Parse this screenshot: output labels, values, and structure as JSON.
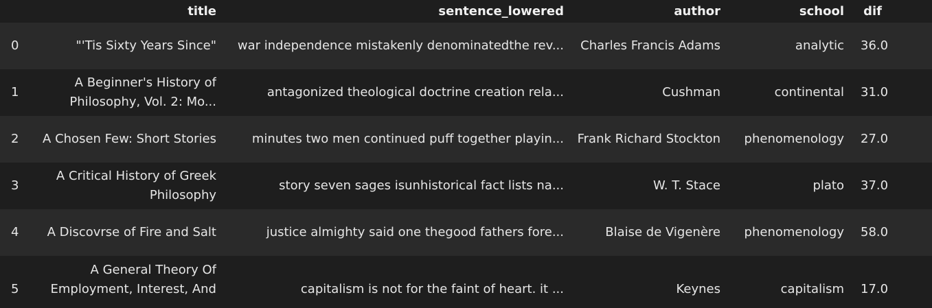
{
  "columns": {
    "index": "",
    "title": "title",
    "sentence_lowered": "sentence_lowered",
    "author": "author",
    "school": "school",
    "dif": "dif"
  },
  "rows": [
    {
      "index": "0",
      "title": "\"'Tis Sixty Years Since\"",
      "sentence_lowered": "war independence mistakenly denominatedthe rev...",
      "author": "Charles Francis Adams",
      "school": "analytic",
      "dif": "36.0"
    },
    {
      "index": "1",
      "title": "A Beginner's History of Philosophy, Vol. 2: Mo...",
      "sentence_lowered": "antagonized theological doctrine creation rela...",
      "author": "Cushman",
      "school": "continental",
      "dif": "31.0"
    },
    {
      "index": "2",
      "title": "A Chosen Few: Short Stories",
      "sentence_lowered": "minutes two men continued puff together playin...",
      "author": "Frank Richard Stockton",
      "school": "phenomenology",
      "dif": "27.0"
    },
    {
      "index": "3",
      "title": "A Critical History of Greek Philosophy",
      "sentence_lowered": "story seven sages isunhistorical fact lists na...",
      "author": "W. T. Stace",
      "school": "plato",
      "dif": "37.0"
    },
    {
      "index": "4",
      "title": "A Discovrse of Fire and Salt",
      "sentence_lowered": "justice almighty said one thegood fathers fore...",
      "author": "Blaise de Vigenère",
      "school": "phenomenology",
      "dif": "58.0"
    },
    {
      "index": "5",
      "title": "A General Theory Of Employment, Interest, And ...",
      "sentence_lowered": "capitalism is not for the faint of heart. it ...",
      "author": "Keynes",
      "school": "capitalism",
      "dif": "17.0"
    }
  ],
  "colors": {
    "background": "#1e1e1e",
    "stripe": "#2a2a2a",
    "text": "#e6e6e6",
    "header_text": "#f0f0f0"
  }
}
